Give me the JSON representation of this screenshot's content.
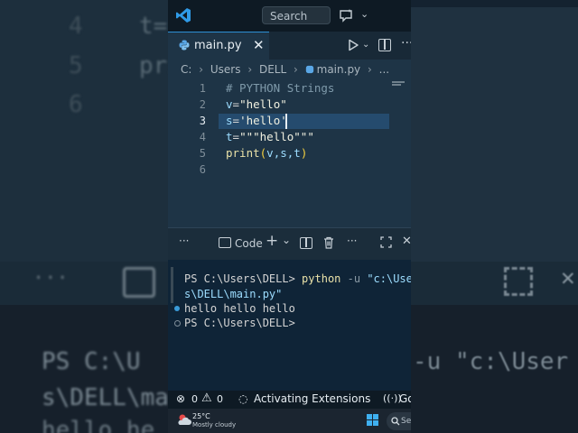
{
  "titlebar": {
    "search_placeholder": "Search"
  },
  "tab": {
    "label": "main.py",
    "close": "✕"
  },
  "breadcrumb": [
    "C:",
    "Users",
    "DELL",
    "main.py",
    "..."
  ],
  "editor": {
    "line_numbers": [
      "1",
      "2",
      "3",
      "4",
      "5",
      "6"
    ],
    "active_line": 3
  },
  "code": {
    "l1": "# PYTHON Strings",
    "l2_var": "v",
    "l2_eq": "=",
    "l2_str": "\"hello\"",
    "l3_var": "s",
    "l3_eq": "=",
    "l3_str": "'hello'",
    "l4_var": "t",
    "l4_eq": "=",
    "l4_str": "\"\"\"hello\"\"\"",
    "l5_fn": "print",
    "l5_open": "(",
    "l5_args": "v,s,t",
    "l5_close": ")"
  },
  "panel": {
    "more": "···",
    "shell_label": "Code",
    "add": "+",
    "chev": "⌄",
    "more2": "···"
  },
  "terminal": {
    "prompt1": "PS C:\\Users\\DELL> ",
    "cmd": "python",
    "flag": " -u ",
    "arg1": "\"c:\\User",
    "arg2": "s\\DELL\\main.py\"",
    "output": "hello hello hello",
    "prompt2": "PS C:\\Users\\DELL>"
  },
  "status": {
    "errors": "0",
    "warnings": "0",
    "activity": "Activating Extensions",
    "right": "Go"
  },
  "taskbar": {
    "temp": "25°C",
    "condition": "Mostly cloudy",
    "search": "Se"
  },
  "background": {
    "num4": "4",
    "num5": "5",
    "num6": "6",
    "frag_t": "t=",
    "frag_pri": "pri",
    "frag_ps": "PS C:\\U",
    "frag_s": "s\\DELL\\ma",
    "frag_hello": "hello he",
    "frag_right1": "-u \"c:\\User",
    "frag_right_dots": "···"
  },
  "colors": {
    "accent": "#2d8fd5",
    "editor_bg": "#1e3446",
    "terminal_bg": "#0f2437"
  }
}
